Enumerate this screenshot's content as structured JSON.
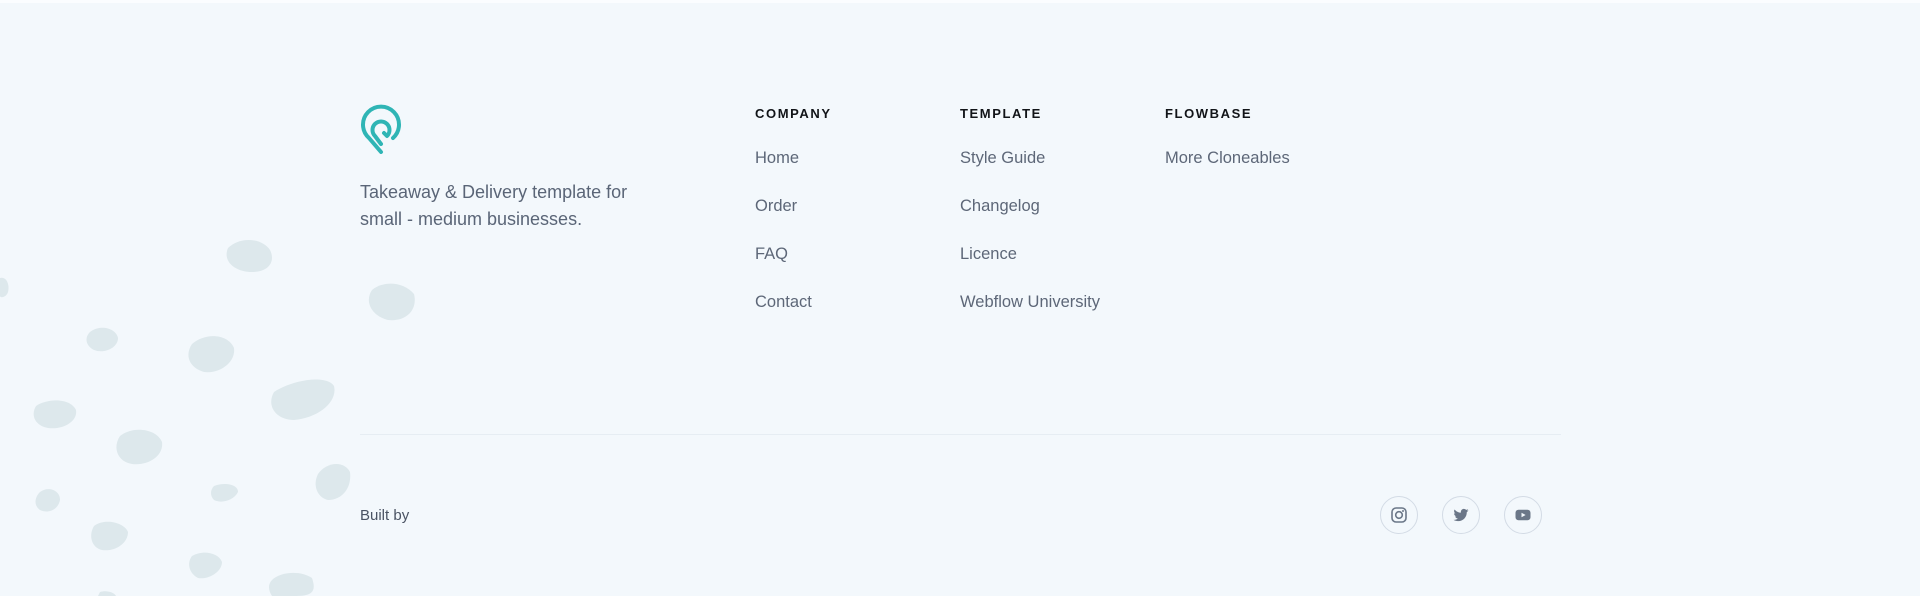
{
  "brand": {
    "logo_icon": "map-pin-logo-icon",
    "accent_color": "#2fb5b5",
    "tagline": "Takeaway & Delivery template for small - medium businesses."
  },
  "columns": [
    {
      "heading": "COMPANY",
      "links": [
        "Home",
        "Order",
        "FAQ",
        "Contact"
      ]
    },
    {
      "heading": "TEMPLATE",
      "links": [
        "Style Guide",
        "Changelog",
        "Licence",
        "Webflow University"
      ]
    },
    {
      "heading": "FLOWBASE",
      "links": [
        "More Cloneables"
      ]
    }
  ],
  "bottom": {
    "built_by": "Built by",
    "socials": [
      {
        "name": "instagram",
        "icon": "instagram-icon"
      },
      {
        "name": "twitter",
        "icon": "twitter-icon"
      },
      {
        "name": "youtube",
        "icon": "youtube-icon"
      }
    ]
  }
}
